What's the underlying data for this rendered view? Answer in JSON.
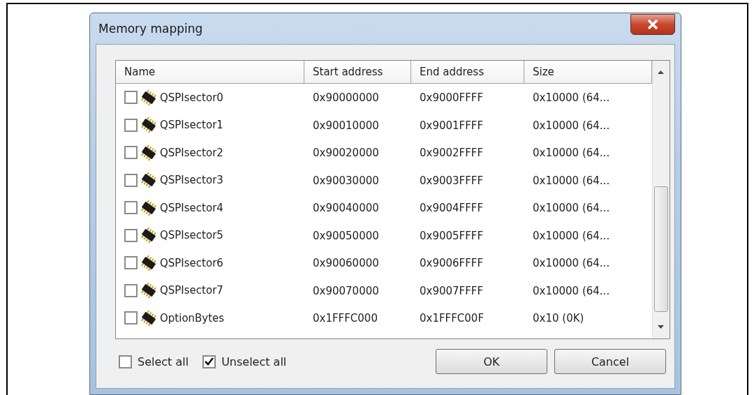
{
  "window": {
    "title": "Memory mapping"
  },
  "table": {
    "columns": [
      "Name",
      "Start address",
      "End address",
      "Size"
    ],
    "rows": [
      {
        "checked": false,
        "cells": [
          "QSPIsector0",
          "0x90000000",
          "0x9000FFFF",
          "0x10000 (64..."
        ]
      },
      {
        "checked": false,
        "cells": [
          "QSPIsector1",
          "0x90010000",
          "0x9001FFFF",
          "0x10000 (64..."
        ]
      },
      {
        "checked": false,
        "cells": [
          "QSPIsector2",
          "0x90020000",
          "0x9002FFFF",
          "0x10000 (64..."
        ]
      },
      {
        "checked": false,
        "cells": [
          "QSPIsector3",
          "0x90030000",
          "0x9003FFFF",
          "0x10000 (64..."
        ]
      },
      {
        "checked": false,
        "cells": [
          "QSPIsector4",
          "0x90040000",
          "0x9004FFFF",
          "0x10000 (64..."
        ]
      },
      {
        "checked": false,
        "cells": [
          "QSPIsector5",
          "0x90050000",
          "0x9005FFFF",
          "0x10000 (64..."
        ]
      },
      {
        "checked": false,
        "cells": [
          "QSPIsector6",
          "0x90060000",
          "0x9006FFFF",
          "0x10000 (64..."
        ]
      },
      {
        "checked": false,
        "cells": [
          "QSPIsector7",
          "0x90070000",
          "0x9007FFFF",
          "0x10000 (64..."
        ]
      },
      {
        "checked": false,
        "cells": [
          "OptionBytes",
          "0x1FFFC000",
          "0x1FFFC00F",
          "0x10 (0K)"
        ]
      }
    ]
  },
  "options": [
    {
      "label": "Select all",
      "checked": false
    },
    {
      "label": "Unselect all",
      "checked": true
    }
  ],
  "buttons": [
    "OK",
    "Cancel"
  ]
}
